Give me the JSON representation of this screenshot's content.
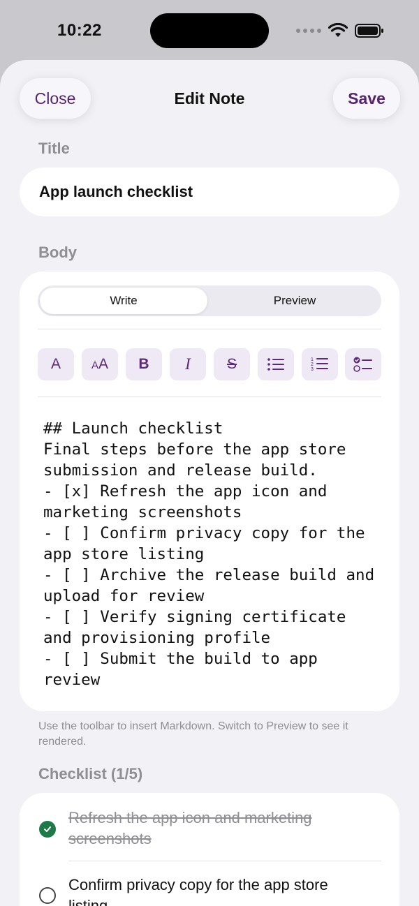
{
  "status": {
    "time": "10:22"
  },
  "nav": {
    "close_label": "Close",
    "title": "Edit Note",
    "save_label": "Save"
  },
  "title_section": {
    "label": "Title",
    "value": "App launch checklist"
  },
  "body_section": {
    "label": "Body",
    "tabs": [
      {
        "label": "Write",
        "selected": true
      },
      {
        "label": "Preview",
        "selected": false
      }
    ],
    "toolbar": [
      {
        "icon": "text-icon",
        "glyph": "A"
      },
      {
        "icon": "text-size-icon",
        "glyph": "AA"
      },
      {
        "icon": "bold-icon",
        "glyph": "B"
      },
      {
        "icon": "italic-icon",
        "glyph": "I"
      },
      {
        "icon": "strikethrough-icon",
        "glyph": "S"
      },
      {
        "icon": "bullet-list-icon",
        "glyph": ""
      },
      {
        "icon": "numbered-list-icon",
        "glyph": ""
      },
      {
        "icon": "checklist-icon",
        "glyph": ""
      }
    ],
    "text": "## Launch checklist\nFinal steps before the app store submission and release build.\n- [x] Refresh the app icon and marketing screenshots\n- [ ] Confirm privacy copy for the app store listing\n- [ ] Archive the release build and upload for review\n- [ ] Verify signing certificate and provisioning profile\n- [ ] Submit the build to app review"
  },
  "hint": "Use the toolbar to insert Markdown. Switch to Preview to see it rendered.",
  "checklist": {
    "label": "Checklist (1/5)",
    "items": [
      {
        "text": "Refresh the app icon and marketing screenshots",
        "done": true
      },
      {
        "text": "Confirm privacy copy for the app store listing",
        "done": false
      }
    ]
  },
  "colors": {
    "accent": "#54246e",
    "done_green": "#1f7a4a",
    "background": "#f2f1f6"
  }
}
